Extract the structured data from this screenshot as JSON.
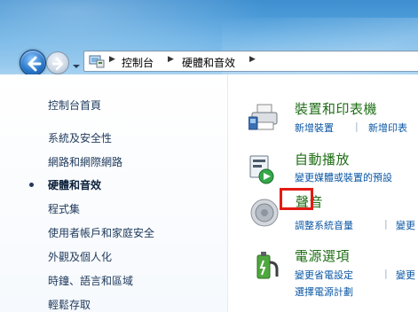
{
  "address_bar": {
    "crumbs": [
      "控制台",
      "硬體和音效"
    ]
  },
  "left_nav": {
    "home": "控制台首頁",
    "items": [
      {
        "label": "系統及安全性",
        "current": false
      },
      {
        "label": "網路和網際網路",
        "current": false
      },
      {
        "label": "硬體和音效",
        "current": true
      },
      {
        "label": "程式集",
        "current": false
      },
      {
        "label": "使用者帳戶和家庭安全",
        "current": false
      },
      {
        "label": "外觀及個人化",
        "current": false
      },
      {
        "label": "時鐘、語言和區域",
        "current": false
      },
      {
        "label": "輕鬆存取",
        "current": false
      }
    ]
  },
  "categories": [
    {
      "title": "裝置和印表機",
      "icon": "printer-icon",
      "links": [
        "新增裝置",
        "新增印表"
      ]
    },
    {
      "title": "自動播放",
      "icon": "autoplay-icon",
      "links": [
        "變更媒體或裝置的預設"
      ]
    },
    {
      "title": "聲音",
      "icon": "speaker-icon",
      "links": [
        "調整系統音量",
        "變更"
      ]
    },
    {
      "title": "電源選項",
      "icon": "power-icon",
      "links": [
        "變更省電設定",
        "變更",
        "選擇電源計劃"
      ]
    }
  ],
  "colors": {
    "category_title": "#1f6e16",
    "link": "#0b57a4",
    "highlight": "#e21b14"
  }
}
